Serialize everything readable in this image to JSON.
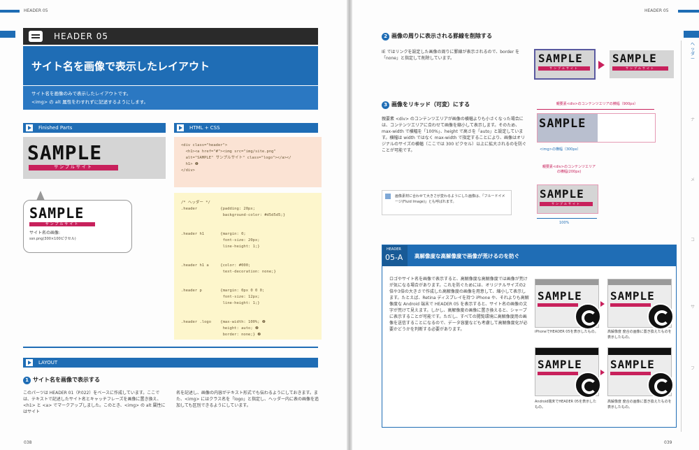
{
  "left": {
    "running_head": "HEADER 05",
    "header_label": "HEADER 05",
    "title": "サイト名を画像で表示したレイアウト",
    "intro_1": "サイト名を画像のみで表示したレイアウトです。",
    "intro_2": "<img> の alt 属性をわすれずに記述するようにします。",
    "finished_parts": "Finished Parts",
    "html_css": "HTML + CSS",
    "sample_big": "SAMPLE",
    "sample_sub": "サンプルサイト",
    "callout_caption_1": "サイト名の画像:",
    "callout_caption_2": "ssn.png(300×100ピクセル)",
    "html_code": "<div class=\"header\">\n  <h1><a href=\"#\"><img src=\"img/site.png\"\n  alt=\"SAMPLE\" サンプルサイト\" class=\"logo\"></a></\n  h1> ❶\n</div>",
    "css_code": "/* ヘッダー */\n.header          {padding: 20px;\n                  background-color: #d5d5d5;}\n\n\n.header h1       {margin: 0;\n                  font-size: 20px;\n                  line-height: 1;}\n\n\n.header h1 a     {color: #000;\n                  text-decoration: none;}\n\n\n.header p        {margin: 0px 0 0 0;\n                  font-size: 12px;\n                  line-height: 1;}\n\n\n.header .logo    {max-width: 100%; ❷\n                  height: auto; ❷\n                  border: none;} ❷",
    "layout_label": "LAYOUT",
    "sec1_num": "1",
    "sec1_title": "サイト名を画像で表示する",
    "sec1_col1": "このパーツは HEADER 01（P.022）をベースに作成しています。ここでは、テキストで記述したサイト名とキャッチフレーズを画像に置き換え、<h1> と <a> でマークアップしました。このとき、<img> の alt 属性にはサイト",
    "sec1_col2": "名を記述し、画像の内容がテキスト形式でも伝わるようにしておきます。また、<img> にはクラス名を「logo」と指定し、ヘッダー内に表の画像を追加しても区別できるようにしています。",
    "page_no": "038"
  },
  "right": {
    "running_head": "HEADER 05",
    "sec2_num": "2",
    "sec2_title": "画像の周りに表示される罫線を削除する",
    "sec2_body": "IE ではリンクを設定した画像の周りに罫線が表示されるので、border を「none」と指定して削除しています。",
    "sec3_num": "3",
    "sec3_title": "画像をリキッド（可変）にする",
    "sec3_body": "親要素 <div> のコンテンツエリアが画像の横幅よりも小さくなった場合には、コンテンツエリアに合わせて画像を縮小して表示します。そのため、max-width で横幅を「100%」、height で高さを「auto」と設定しています。横幅は width ではなく max-width で指定することにより、画像はオリジナルのサイズの横幅（ここでは 300 ピクセル）以上に拡大されるのを防ぐことが可能です。",
    "fig_label_top": "親要素<div>のコンテンツエリアの横幅（900px）",
    "fig_label_img": "<img>の横幅（300px）",
    "fig_label_mid": "親要素<div>のコンテンツエリアの横幅(200px)",
    "fig_label_100": "100%",
    "note": "画像素材に合わせて大きさが変わるようにした画像は、「フルードイメージ(Fluid Image)」とも呼ばれます。",
    "boxA_kicker": "HEADER",
    "boxA_code": "05-A",
    "boxA_title": "高解像度な高解像度で画像が荒けるのを防ぐ",
    "boxA_body": "ロゴやサイト名を画像で表示すると、高解像度な高解像度では画像が荒けが気になる場合があります。これを防ぐためには、オリジナルサイズの2倍や3倍の大きさで作成した高解像度の画像を用意して、縮小して表示します。たとえば、Retina ディスプレイを持つ iPhone や、それよりも高解像度な Android 端末で HEADER 05 を表示すると、サイト名の画像の文字が荒けて見えます。しかし、高解像度の画像に置き換えると、シャープに表示することが可能です。ただし、すべての閲覧環境に高解像度用の画像を送信することになるので、データ容量なども考慮して高解像度化が必要かどうかを判断する必要があります。",
    "cap1": "iPhoneでHEADER 05を表示したもの。",
    "cap2": "高解像度 度合の画像に置き換えたものを表示したもの。",
    "cap3": "Android端末でHEADER 05を表示したもの。",
    "cap4": "高解像度 度合の画像に置き換えたものを表示したもの。",
    "page_no": "039"
  },
  "colors": {
    "accent": "#1f6db5",
    "pink": "#c8215c",
    "dark": "#222222"
  }
}
